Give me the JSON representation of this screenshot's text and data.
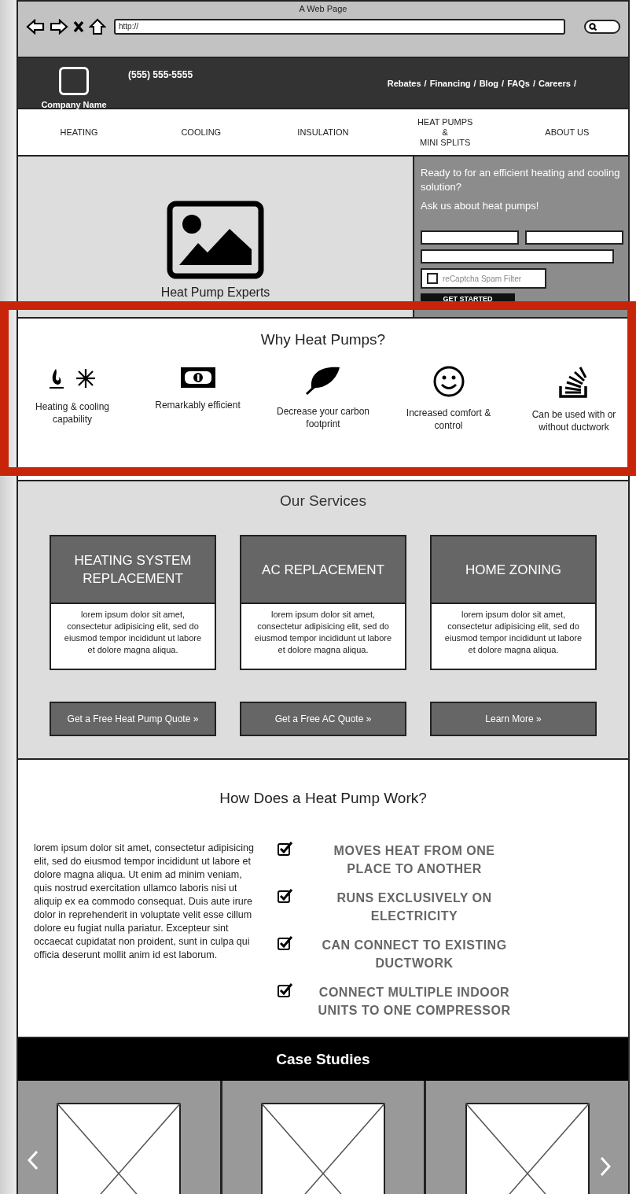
{
  "window": {
    "title": "A Web Page",
    "url": "http://"
  },
  "header": {
    "company": "Company Name",
    "phone": "(555) 555-5555",
    "links": [
      {
        "label": "Rebates",
        "sep": "/"
      },
      {
        "label": "Financing",
        "sep": "/"
      },
      {
        "label": "Blog",
        "sep": "/"
      },
      {
        "label": "FAQs",
        "sep": "/"
      },
      {
        "label": "Careers",
        "sep": "/"
      }
    ]
  },
  "nav": [
    {
      "lines": [
        "HEATING"
      ]
    },
    {
      "lines": [
        "COOLING"
      ]
    },
    {
      "lines": [
        "INSULATION"
      ]
    },
    {
      "lines": [
        "HEAT PUMPS",
        "&",
        "MINI SPLITS"
      ]
    },
    {
      "lines": [
        "ABOUT US"
      ]
    }
  ],
  "hero": {
    "caption": "Heat Pump Experts",
    "form": {
      "lines": [
        "Ready to for an efficient heating and cooling solution?",
        "Ask us about heat pumps!"
      ],
      "captcha": {
        "label": "reCaptcha Spam Filter",
        "checked": false
      },
      "button": "GET STARTED"
    }
  },
  "why": {
    "title": "Why Heat Pumps?",
    "items": [
      {
        "kind": "flame-snow",
        "label": "Heating & cooling capability"
      },
      {
        "kind": "money",
        "label": "Remarkably efficient"
      },
      {
        "kind": "leaf",
        "label": "Decrease your carbon footprint"
      },
      {
        "kind": "smile",
        "label": "Increased comfort & control"
      },
      {
        "kind": "stack",
        "label": "Can be used with or without ductwork"
      }
    ]
  },
  "services": {
    "title": "Our Services",
    "cards": [
      {
        "title": "HEATING SYSTEM REPLACEMENT",
        "body": "lorem ipsum dolor sit amet, consectetur adipisicing elit, sed do eiusmod tempor incididunt ut labore et dolore magna aliqua.",
        "button": "Get a Free Heat Pump Quote »"
      },
      {
        "title": "AC REPLACEMENT",
        "body": "lorem ipsum dolor sit amet, consectetur adipisicing elit, sed do eiusmod tempor incididunt ut labore et dolore magna aliqua.",
        "button": "Get a Free AC Quote »"
      },
      {
        "title": "HOME ZONING",
        "body": "lorem ipsum dolor sit amet, consectetur adipisicing elit, sed do eiusmod tempor incididunt ut labore et dolore magna aliqua.",
        "button": "Learn More »"
      }
    ]
  },
  "how": {
    "title": "How Does a Heat Pump Work?",
    "text": "lorem ipsum dolor sit amet, consectetur adipisicing elit, sed do eiusmod tempor incididunt ut labore et dolore magna aliqua. Ut enim ad minim veniam, quis nostrud exercitation ullamco laboris nisi ut aliquip ex ea commodo consequat. Duis aute irure dolor in reprehenderit in voluptate velit esse cillum dolore eu fugiat nulla pariatur. Excepteur sint occaecat cupidatat non proident, sunt in culpa qui officia deserunt mollit anim id est laborum.",
    "points": [
      {
        "text": "MOVES HEAT FROM ONE PLACE TO ANOTHER",
        "checked": true
      },
      {
        "text": "RUNS EXCLUSIVELY ON ELECTRICITY",
        "checked": true
      },
      {
        "text": "CAN CONNECT TO EXISTING DUCTWORK",
        "checked": true
      },
      {
        "text": "CONNECT MULTIPLE INDOOR UNITS TO ONE COMPRESSOR",
        "checked": true
      }
    ]
  },
  "case_studies": {
    "title": "Case Studies",
    "slides": [
      {
        "kind": "placeholder"
      },
      {
        "kind": "placeholder"
      },
      {
        "kind": "placeholder"
      }
    ]
  }
}
